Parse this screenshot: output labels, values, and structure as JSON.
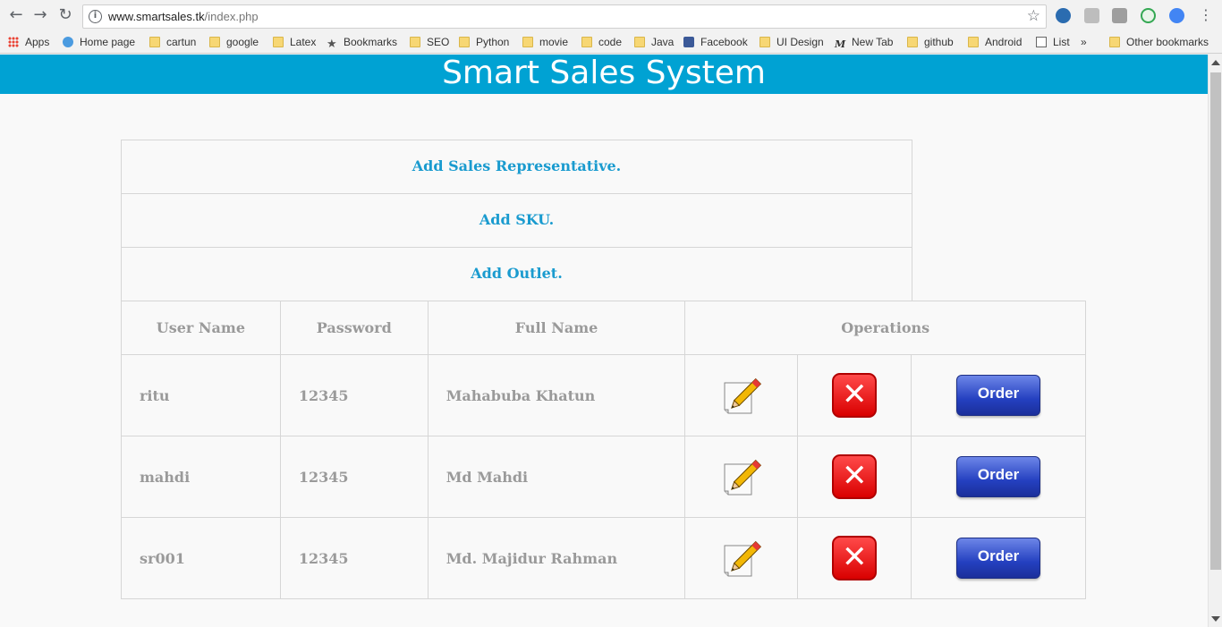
{
  "browser": {
    "url_domain": "www.smartsales.tk",
    "url_path": "/index.php",
    "bookmarks": [
      "Apps",
      "Home page",
      "cartun",
      "google",
      "Latex",
      "Bookmarks",
      "SEO",
      "Python",
      "movie",
      "code",
      "Java",
      "Facebook",
      "UI Design",
      "New Tab",
      "github",
      "Android",
      "List"
    ],
    "overflow": "»",
    "other_bookmarks": "Other bookmarks"
  },
  "header": {
    "title": "Smart Sales System"
  },
  "actions": {
    "add_sr": "Add Sales Representative.",
    "add_sku": "Add SKU.",
    "add_outlet": "Add Outlet."
  },
  "table": {
    "columns": [
      "User Name",
      "Password",
      "Full Name",
      "Operations"
    ],
    "rows": [
      {
        "username": "ritu",
        "password": "12345",
        "fullname": "Mahabuba Khatun"
      },
      {
        "username": "mahdi",
        "password": "12345",
        "fullname": "Md Mahdi"
      },
      {
        "username": "sr001",
        "password": "12345",
        "fullname": "Md. Majidur Rahman"
      }
    ],
    "order_label": "Order",
    "delete_symbol": "✕"
  },
  "colors": {
    "header_bg": "#00a2d3",
    "link": "#1a9bcf",
    "text_muted": "#9a9a9a"
  }
}
